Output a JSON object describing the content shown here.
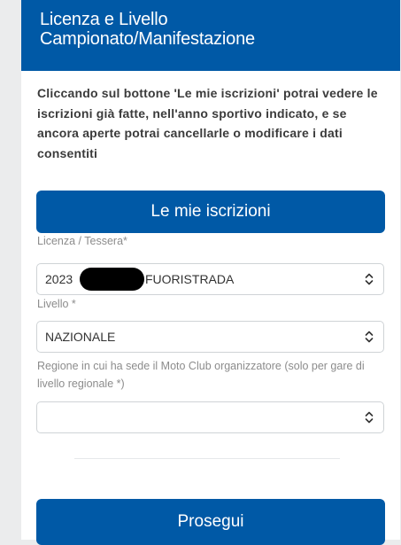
{
  "header": {
    "title_line1": "Licenza e Livello",
    "title_line2": "Campionato/Manifestazione"
  },
  "info_text": "Cliccando sul bottone 'Le mie iscrizioni' potrai vedere le iscrizioni già fatte, nell'anno sportivo indicato, e se ancora aperte potrai cancellarle o modificare i dati consentiti",
  "buttons": {
    "iscrizioni_label": "Le mie iscrizioni",
    "prosegui_label": "Prosegui"
  },
  "fields": {
    "licenza": {
      "label": "Licenza / Tessera*",
      "value_year": "2023",
      "value_type": "FUORISTRADA"
    },
    "livello": {
      "label": "Livello *",
      "value": "NAZIONALE"
    },
    "regione": {
      "label": "Regione in cui ha sede il Moto Club organizzatore (solo per gare di livello regionale *)",
      "value": ""
    }
  },
  "colors": {
    "primary": "#0059a6",
    "page_bg": "#ebeced",
    "text": "#3b3b3b",
    "label": "#8c8c8c"
  },
  "icons": [
    "select-chevron-icon"
  ]
}
